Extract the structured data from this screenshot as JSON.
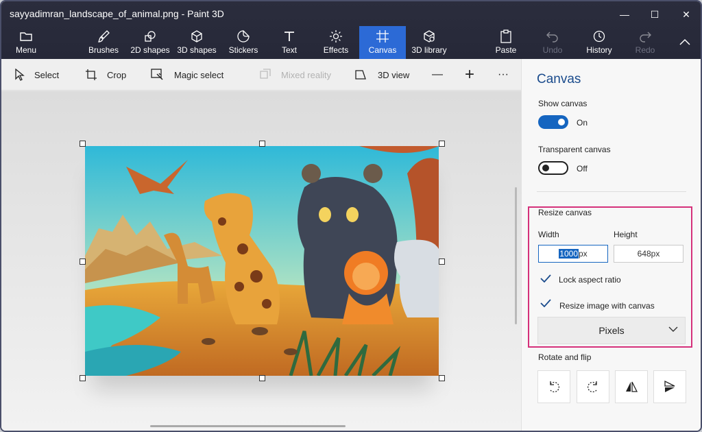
{
  "window": {
    "title": "sayyadimran_landscape_of_animal.png - Paint 3D",
    "minimize": "—",
    "maximize": "☐",
    "close": "✕"
  },
  "ribbon": {
    "menu": "Menu",
    "brushes": "Brushes",
    "shapes2d": "2D shapes",
    "shapes3d": "3D shapes",
    "stickers": "Stickers",
    "text": "Text",
    "effects": "Effects",
    "canvas": "Canvas",
    "library3d": "3D library",
    "paste": "Paste",
    "undo": "Undo",
    "history": "History",
    "redo": "Redo"
  },
  "toolbar": {
    "select": "Select",
    "crop": "Crop",
    "magic_select": "Magic select",
    "mixed_reality": "Mixed reality",
    "view3d": "3D view",
    "zoom_out": "—",
    "zoom_in": "+",
    "more": "···"
  },
  "panel": {
    "title": "Canvas",
    "show_canvas_label": "Show canvas",
    "show_canvas_state": "On",
    "transparent_label": "Transparent canvas",
    "transparent_state": "Off",
    "resize_label": "Resize canvas",
    "width_label": "Width",
    "height_label": "Height",
    "width_value": "1000",
    "width_unit": "px",
    "height_value": "648px",
    "lock_aspect": "Lock aspect ratio",
    "resize_image": "Resize image with canvas",
    "units": "Pixels",
    "rotate_label": "Rotate and flip"
  },
  "colors": {
    "accent": "#2c6ad6",
    "highlight": "#d5307a",
    "titlebar": "#2b2d3d"
  }
}
